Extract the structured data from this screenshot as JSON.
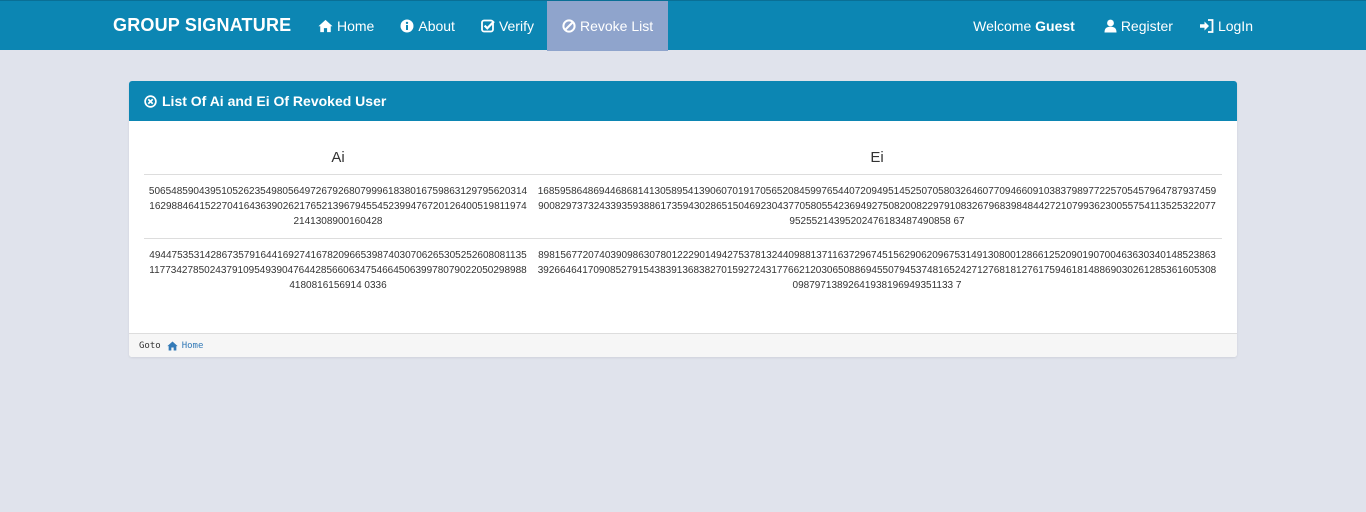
{
  "navbar": {
    "brand": "GROUP SIGNATURE",
    "items": [
      {
        "label": "Home",
        "icon": "home-icon"
      },
      {
        "label": "About",
        "icon": "info-icon"
      },
      {
        "label": "Verify",
        "icon": "check-square-icon"
      },
      {
        "label": "Revoke List",
        "icon": "ban-icon",
        "active": true
      }
    ],
    "welcome_prefix": "Welcome",
    "welcome_user": "Guest",
    "register_label": "Register",
    "login_label": "LogIn"
  },
  "panel": {
    "title": "List Of Ai and Ei Of Revoked User",
    "columns": [
      "Ai",
      "Ei"
    ],
    "rows": [
      {
        "ai": "50654859043951052623549805649726792680799961838016759863129795620314162988464152270416436390262176521396794554523994767201264005198119742141308900160428",
        "ei": "168595864869446868141305895413906070191705652084599765440720949514525070580326460770946609103837989772257054579647879374599008297373243393593886173594302865150469230437705805542369492750820082297910832679683984844272107993623005575411352532207795255214395202476183487490858 67"
      },
      {
        "ai": "49447535314286735791644169274167820966539874030706265305252608081135117734278502437910954939047644285660634754664506399780790220502989884180816156914 0336",
        "ei": "898156772074039098630780122290149427537813244098813711637296745156290620967531491308001286612520901907004636303401485238633926646417090852791543839136838270159272431776621203065088694550794537481652427127681812761759461814886903026128536160530809879713892641938196949351133 7"
      }
    ],
    "footer_goto": "Goto",
    "footer_link": "Home"
  },
  "colors": {
    "navbar_bg": "#0c86b3",
    "active_tab_bg": "#8fa4cc",
    "page_bg": "#e0e3ec",
    "link": "#337ab7"
  }
}
